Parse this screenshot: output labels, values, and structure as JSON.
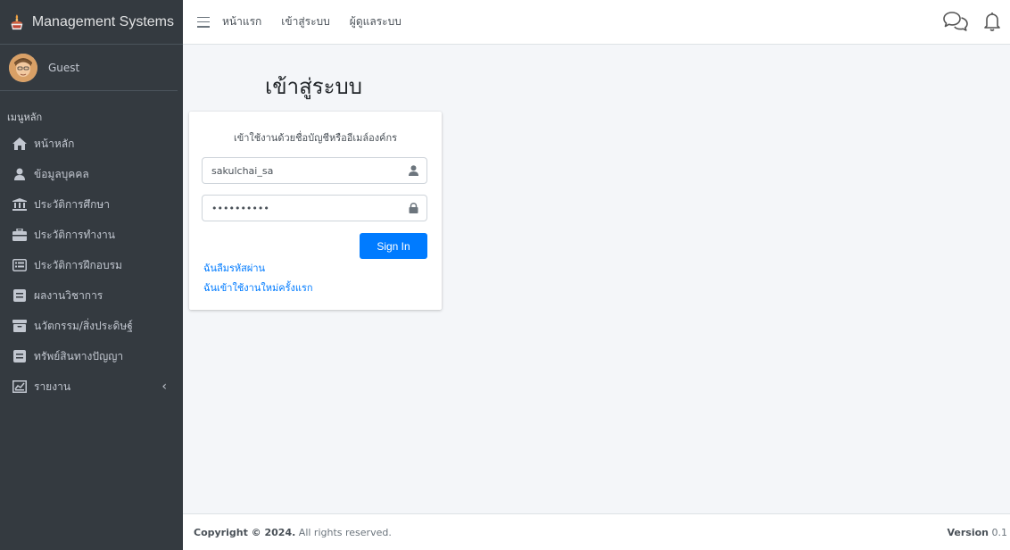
{
  "brand": {
    "name": "Management Systems"
  },
  "user": {
    "name": "Guest"
  },
  "sidebar": {
    "header": "เมนูหลัก",
    "items": [
      {
        "label": "หน้าหลัก",
        "icon": "home-icon"
      },
      {
        "label": "ข้อมูลบุคคล",
        "icon": "user-icon"
      },
      {
        "label": "ประวัติการศึกษา",
        "icon": "university-icon"
      },
      {
        "label": "ประวัติการทำงาน",
        "icon": "briefcase-icon"
      },
      {
        "label": "ประวัติการฝึกอบรม",
        "icon": "list-alt-icon"
      },
      {
        "label": "ผลงานวิชาการ",
        "icon": "book-icon"
      },
      {
        "label": "นวัตกรรม/สิ่งประดิษฐ์",
        "icon": "archive-icon"
      },
      {
        "label": "ทรัพย์สินทางปัญญา",
        "icon": "book-icon"
      },
      {
        "label": "รายงาน",
        "icon": "chart-icon",
        "chevron": "‹"
      }
    ]
  },
  "topnav": {
    "links": [
      "หน้าแรก",
      "เข้าสู่ระบบ",
      "ผู้ดูแลระบบ"
    ]
  },
  "login": {
    "title": "เข้าสู่ระบบ",
    "message": "เข้าใช้งานด้วยชื่อบัญชีหรืออีเมล์องค์กร",
    "username_value": "sakulchai_sa",
    "password_value": "••••••••••",
    "signin_label": "Sign In",
    "forgot_label": "ฉันลืมรหัสผ่าน",
    "first_time_label": "ฉันเข้าใช้งานใหม่ครั้งแรก"
  },
  "footer": {
    "copyright_bold": "Copyright © 2024.",
    "copyright_rest": "All rights reserved.",
    "version_label": "Version",
    "version_value": "0.1"
  },
  "colors": {
    "sidebar_bg": "#343a40",
    "accent": "#007bff",
    "content_bg": "#f4f6f9"
  }
}
